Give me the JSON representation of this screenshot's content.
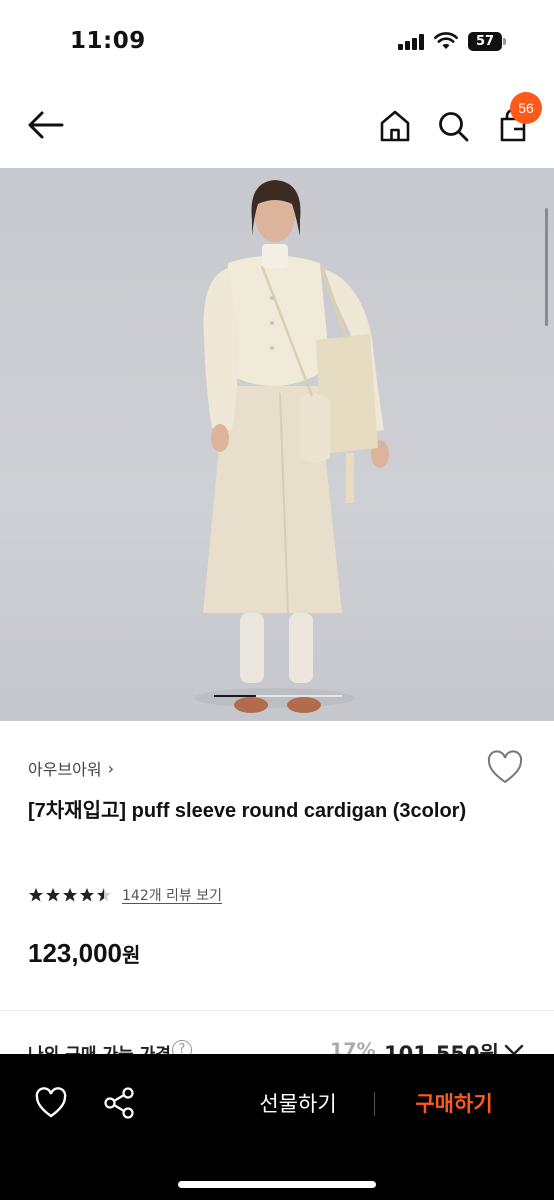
{
  "status_bar": {
    "time": "11:09",
    "battery": "57",
    "icons": [
      "cellular-signal-icon",
      "wifi-icon",
      "battery-icon"
    ]
  },
  "header": {
    "icons": [
      "back-arrow-icon",
      "home-icon",
      "search-icon",
      "cart-icon"
    ],
    "cart_count": "56"
  },
  "hero": {
    "image": "model-photo",
    "carousel_progress": 0.33
  },
  "product": {
    "brand": "아우브아워",
    "brand_chevron": "›",
    "title": "[7차재입고] puff sleeve round cardigan (3color)",
    "rating": 4.5,
    "review_link": "142개 리뷰 보기",
    "price_value": "123,000",
    "price_unit": "원"
  },
  "my_price": {
    "label": "나의 구매 가능 가격",
    "help": "?",
    "discount": "17%",
    "price": "101,550원"
  },
  "action_bar": {
    "gift_label": "선물하기",
    "buy_label": "구매하기"
  },
  "colors": {
    "accent": "#ff5a1a",
    "action_bar_bg": "#000000",
    "text": "#111111"
  }
}
